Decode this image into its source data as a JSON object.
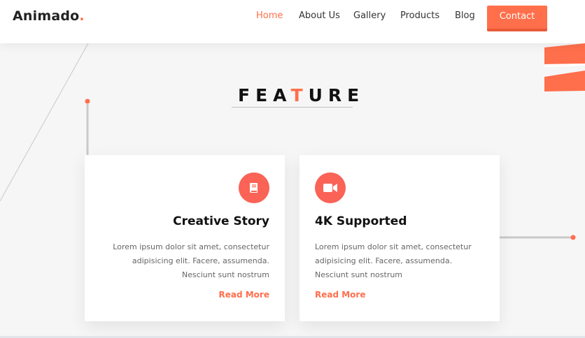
{
  "brand": {
    "name": "Animado",
    "dot": "."
  },
  "nav": {
    "items": [
      {
        "label": "Home",
        "active": true
      },
      {
        "label": "About Us",
        "active": false
      },
      {
        "label": "Gallery",
        "active": false
      },
      {
        "label": "Products",
        "active": false
      },
      {
        "label": "Blog",
        "active": false
      }
    ],
    "contact_label": "Contact"
  },
  "section": {
    "title_prefix": "FEA",
    "title_highlight": "T",
    "title_suffix": "URE"
  },
  "cards": [
    {
      "icon": "book-icon",
      "title": "Creative Story",
      "text": "Lorem ipsum dolor sit amet, consectetur adipisicing elit. Facere, assumenda. Nesciunt sunt nostrum",
      "link": "Read More"
    },
    {
      "icon": "video-camera-icon",
      "title": "4K Supported",
      "text": "Lorem ipsum dolor sit amet, consectetur adipisicing elit. Facere, assumenda. Nesciunt sunt nostrum",
      "link": "Read More"
    }
  ],
  "colors": {
    "accent": "#ff6f4b",
    "icon_bg": "#fa6356",
    "text_dark": "#111111",
    "text_muted": "#666666"
  }
}
